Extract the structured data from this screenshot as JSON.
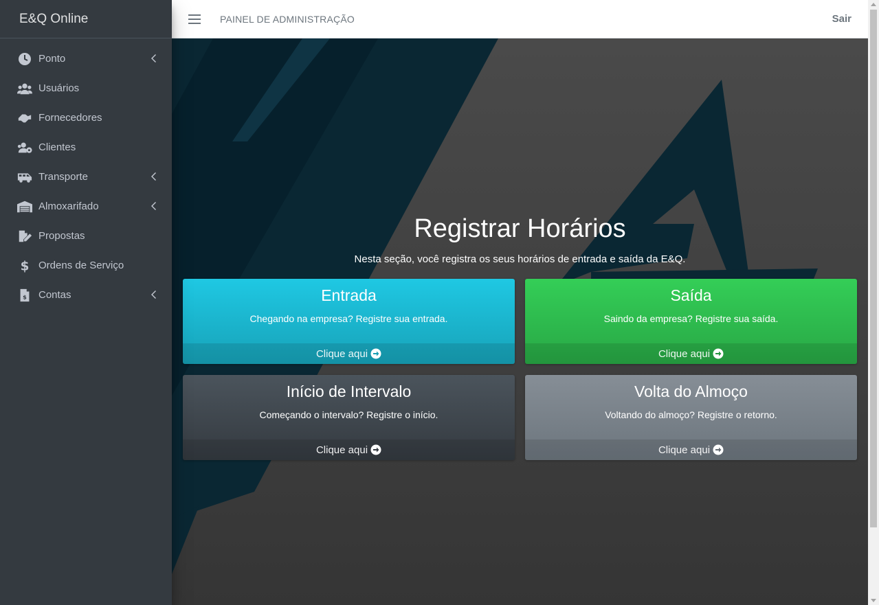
{
  "brand": "E&Q Online",
  "sidebar": {
    "items": [
      {
        "label": "Ponto",
        "icon": "clock-icon",
        "has_submenu": true
      },
      {
        "label": "Usuários",
        "icon": "users-icon",
        "has_submenu": false
      },
      {
        "label": "Fornecedores",
        "icon": "handshake-icon",
        "has_submenu": false
      },
      {
        "label": "Clientes",
        "icon": "users-gear-icon",
        "has_submenu": false
      },
      {
        "label": "Transporte",
        "icon": "shuttle-van-icon",
        "has_submenu": true
      },
      {
        "label": "Almoxarifado",
        "icon": "warehouse-icon",
        "has_submenu": true
      },
      {
        "label": "Propostas",
        "icon": "file-signature-icon",
        "has_submenu": false
      },
      {
        "label": "Ordens de Serviço",
        "icon": "dollar-sign-icon",
        "has_submenu": false
      },
      {
        "label": "Contas",
        "icon": "file-invoice-dollar-icon",
        "has_submenu": true
      }
    ]
  },
  "topbar": {
    "title": "PAINEL DE ADMINISTRAÇÃO",
    "logout_label": "Sair"
  },
  "main": {
    "title": "Registrar Horários",
    "subtitle": "Nesta seção, você registra os seus horários de entrada e saída da E&Q.",
    "cards": [
      {
        "title": "Entrada",
        "text": "Chegando na empresa? Registre sua entrada.",
        "footer": "Clique aqui",
        "color": "#17a2b8"
      },
      {
        "title": "Saída",
        "text": "Saindo da empresa? Registre sua saída.",
        "footer": "Clique aqui",
        "color": "#28a745"
      },
      {
        "title": "Início de Intervalo",
        "text": "Começando o intervalo? Registre o início.",
        "footer": "Clique aqui",
        "color": "#343a40"
      },
      {
        "title": "Volta do Almoço",
        "text": "Voltando do almoço? Registre o retorno.",
        "footer": "Clique aqui",
        "color": "#6c757d"
      }
    ]
  },
  "colors": {
    "sidebar_bg": "#343a40",
    "topbar_bg": "#ffffff",
    "info": "#17a2b8",
    "success": "#28a745"
  }
}
